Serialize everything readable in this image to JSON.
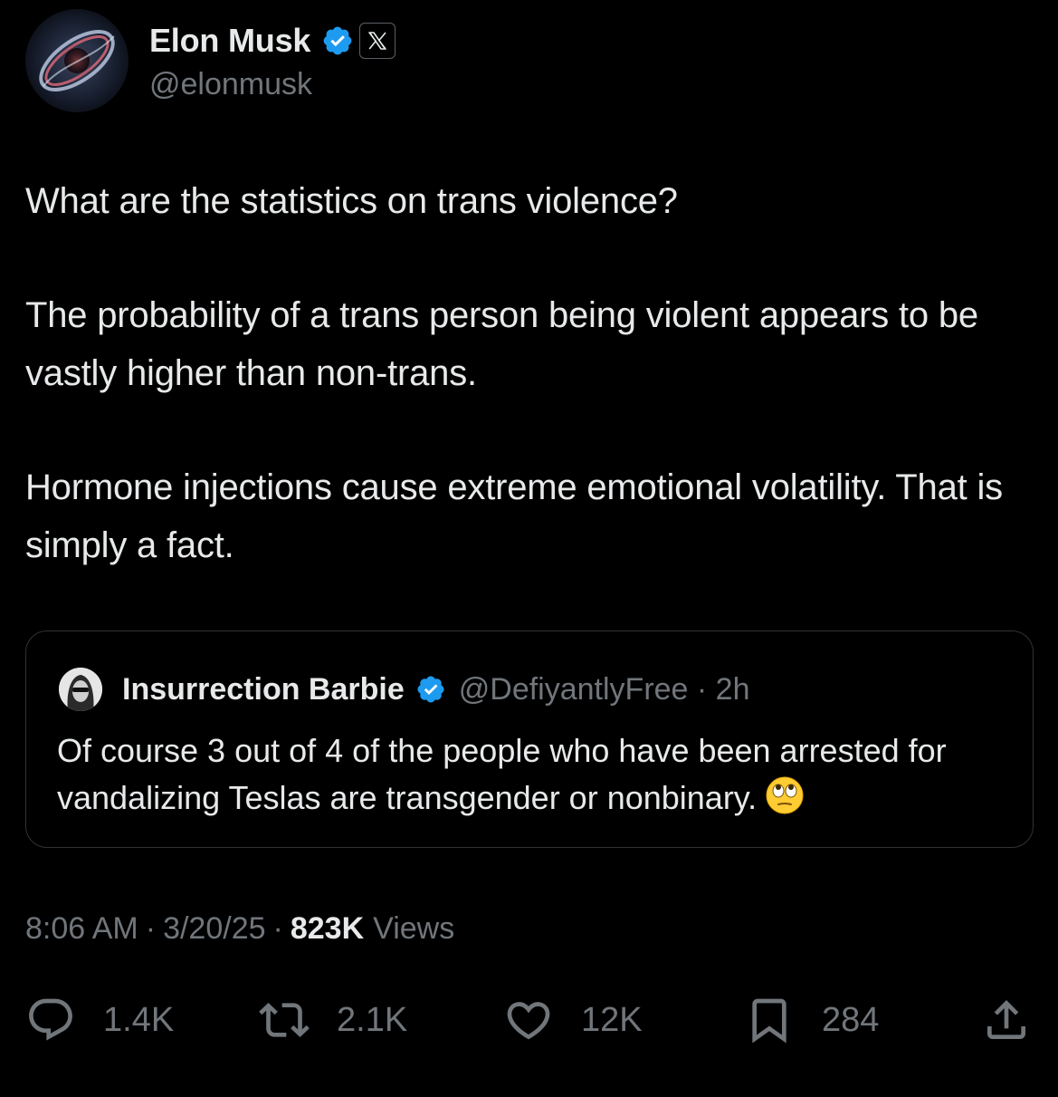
{
  "author": {
    "display_name": "Elon Musk",
    "handle": "@elonmusk",
    "verified": true
  },
  "post": {
    "paragraphs": [
      "What are the statistics on trans violence?",
      "The probability of a trans person being violent appears to be vastly higher than non-trans.",
      "Hormone injections cause extreme emotional volatility. That is simply a fact."
    ]
  },
  "quoted_post": {
    "display_name": "Insurrection Barbie",
    "handle_time": "@DefiyantlyFree · 2h",
    "text": "Of course 3 out of 4 of the people who have been arrested for vandalizing Teslas are transgender or nonbinary.",
    "emoji": "face-with-rolling-eyes"
  },
  "meta": {
    "time": "8:06 AM",
    "date": "3/20/25",
    "views_count": "823K",
    "views_label": "Views",
    "separator": "·"
  },
  "actions": {
    "replies": "1.4K",
    "reposts": "2.1K",
    "likes": "12K",
    "bookmarks": "284"
  },
  "colors": {
    "background": "#000000",
    "text": "#e7e9ea",
    "secondary": "#71767b",
    "verified": "#1d9bf0",
    "border": "#2f3336"
  }
}
